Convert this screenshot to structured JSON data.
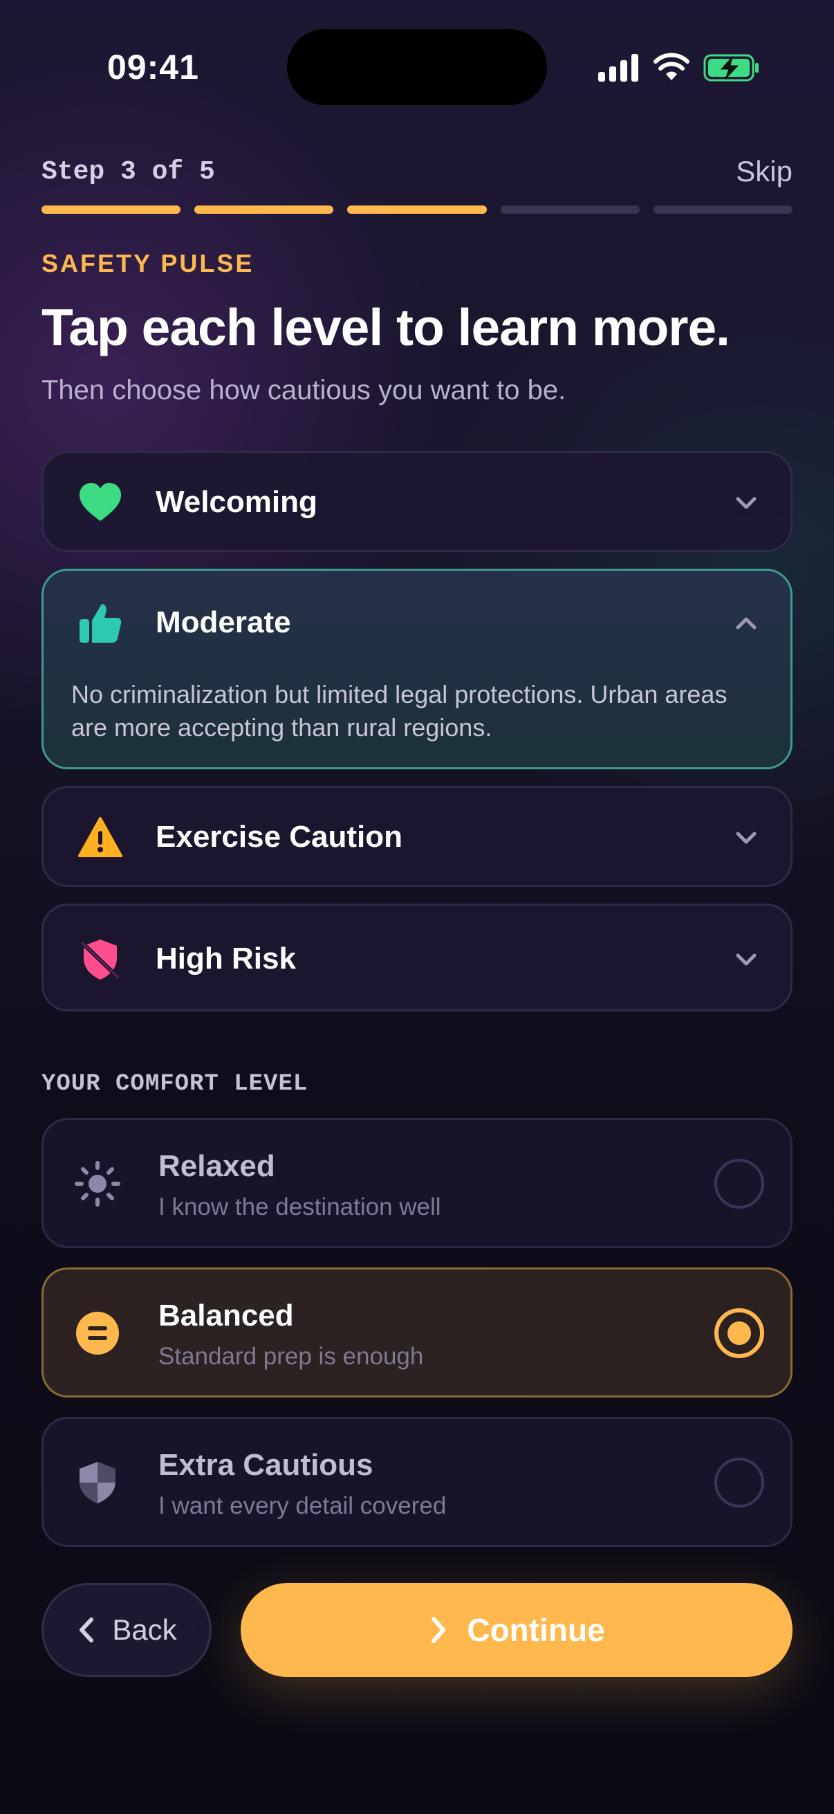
{
  "status_bar": {
    "time": "09:41"
  },
  "header": {
    "step": "Step 3 of 5",
    "skip_label": "Skip",
    "progress": {
      "current": 3,
      "total": 5
    }
  },
  "eyebrow": "SAFETY PULSE",
  "title": "Tap each level to learn more.",
  "subtitle": "Then choose how cautious you want to be.",
  "levels": [
    {
      "label": "Welcoming",
      "icon": "heart-icon",
      "color": "#3ddc84",
      "expanded": false
    },
    {
      "label": "Moderate",
      "icon": "thumbs-up-icon",
      "color": "#2ec9b0",
      "expanded": true,
      "description": "No criminalization but limited legal protections. Urban areas are more accepting than rural regions."
    },
    {
      "label": "Exercise Caution",
      "icon": "warning-icon",
      "color": "#ffb020",
      "expanded": false
    },
    {
      "label": "High Risk",
      "icon": "shield-off-icon",
      "color": "#ff4d8d",
      "expanded": false
    }
  ],
  "comfort": {
    "heading": "YOUR COMFORT LEVEL",
    "selected": "Balanced",
    "options": [
      {
        "name": "Relaxed",
        "subtitle": "I know the destination well",
        "icon": "sun-icon"
      },
      {
        "name": "Balanced",
        "subtitle": "Standard prep is enough",
        "icon": "equals-icon"
      },
      {
        "name": "Extra Cautious",
        "subtitle": "I want every detail covered",
        "icon": "shield-icon"
      }
    ]
  },
  "actions": {
    "back_label": "Back",
    "continue_label": "Continue"
  },
  "colors": {
    "accent": "#ffb84d",
    "moderate_border": "#3e9b8d"
  }
}
